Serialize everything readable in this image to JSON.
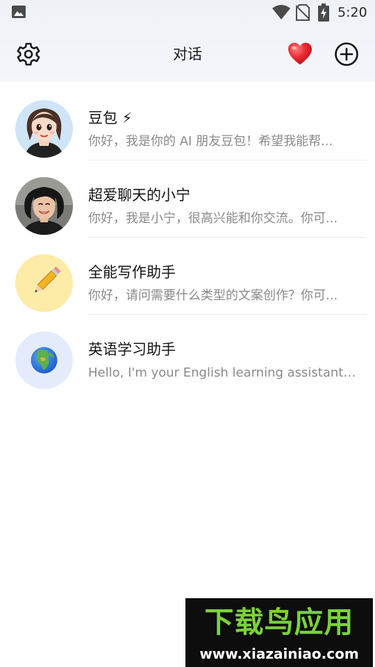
{
  "status_bar": {
    "time": "5:20",
    "icons": [
      "gallery-icon",
      "wifi-icon",
      "no-sim-icon",
      "battery-charging-icon"
    ]
  },
  "header": {
    "title": "对话",
    "left_icon": "gear-icon",
    "right_icons": [
      "heart-icon",
      "add-circle-icon"
    ]
  },
  "chats": [
    {
      "name": "豆包 ⚡",
      "preview": "你好，我是你的 AI 朋友豆包！希望我能帮...",
      "avatar": "cartoon-girl-avatar"
    },
    {
      "name": "超爱聊天的小宁",
      "preview": "你好，我是小宁，很高兴能和你交流。你可...",
      "avatar": "photo-girl-avatar"
    },
    {
      "name": "全能写作助手",
      "preview": "你好，请问需要什么类型的文案创作？你可...",
      "avatar": "pencil-avatar"
    },
    {
      "name": "英语学习助手",
      "preview": "Hello, I'm your English learning assistant. L...",
      "avatar": "globe-avatar"
    }
  ],
  "watermark": {
    "main": "下载鸟应用",
    "url": "www.xiazainiao.com"
  },
  "colors": {
    "header_bg": "#eef2f7",
    "heart": "#e8262e",
    "pencil_bg": "#fdeba8",
    "globe_bg": "#e4ecfb",
    "watermark_green": "#7bd13a"
  }
}
